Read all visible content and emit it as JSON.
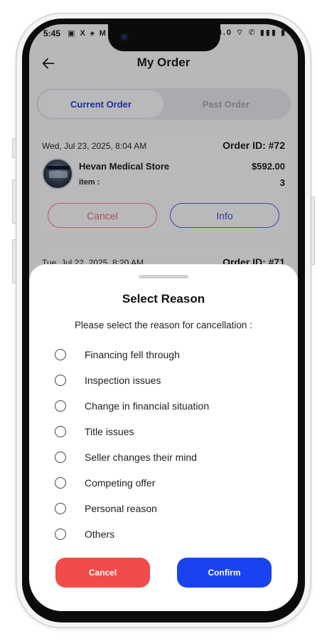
{
  "status_bar": {
    "time": "5:45",
    "left_icons": "▣ X ♠ M ▪",
    "right_icons": "18.0 ⌔ ✆ ▮▮▮ ▮"
  },
  "header": {
    "title": "My Order",
    "back_icon": "arrow-left-icon"
  },
  "tabs": [
    {
      "label": "Current Order",
      "active": true
    },
    {
      "label": "Past Order",
      "active": false
    }
  ],
  "orders": [
    {
      "date": "Wed, Jul 23, 2025, 8:04 AM",
      "order_id": "Order ID: #72",
      "store": "Hevan Medical Store",
      "amount": "$592.00",
      "item_label": "item :",
      "item_count": "3",
      "cancel_label": "Cancel",
      "info_label": "Info"
    },
    {
      "date": "Tue, Jul 22, 2025, 8:20 AM",
      "order_id": "Order ID: #71"
    }
  ],
  "sheet": {
    "title": "Select Reason",
    "subtitle": "Please select the reason for cancellation :",
    "reasons": [
      "Financing fell through",
      "Inspection issues",
      "Change in financial situation",
      "Title issues",
      "Seller changes their mind",
      "Competing offer",
      "Personal reason",
      "Others"
    ],
    "cancel_label": "Cancel",
    "confirm_label": "Confirm"
  },
  "colors": {
    "accent_blue": "#1a43f0",
    "danger_red": "#f24b4b",
    "tab_active_text": "#2a3fd6"
  }
}
